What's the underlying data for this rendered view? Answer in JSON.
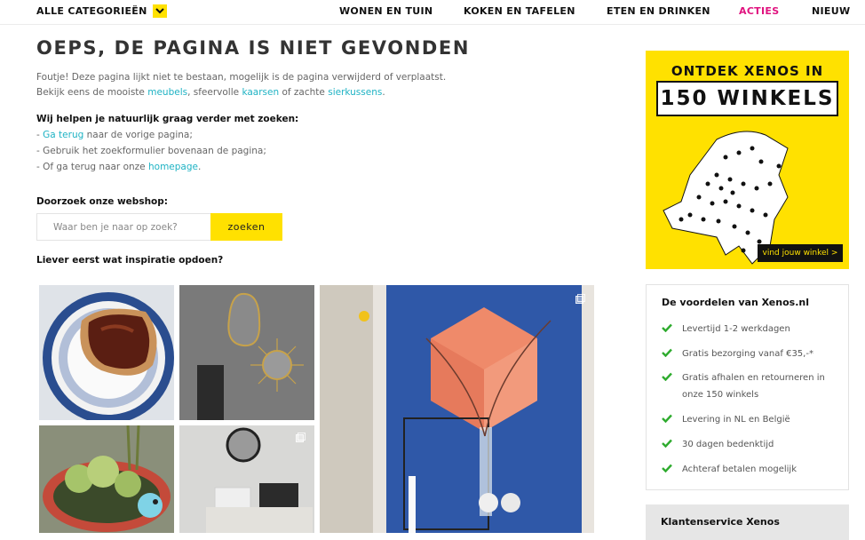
{
  "nav": {
    "categories_label": "ALLE CATEGORIEËN",
    "items": [
      {
        "label": "WONEN EN TUIN"
      },
      {
        "label": "KOKEN EN TAFELEN"
      },
      {
        "label": "ETEN EN DRINKEN"
      },
      {
        "label": "ACTIES"
      },
      {
        "label": "NIEUW"
      }
    ],
    "highlight_color": "#e0137f"
  },
  "page": {
    "title": "OEPS, DE PAGINA IS NIET GEVONDEN",
    "intro_line1": "Foutje! Deze pagina lijkt niet te bestaan, mogelijk is de pagina verwijderd of verplaatst.",
    "intro_line2_prefix": "Bekijk eens de mooiste ",
    "link_meubels": "meubels",
    "intro_line2_mid1": ", sfeervolle ",
    "link_kaarsen": "kaarsen",
    "intro_line2_mid2": " of zachte ",
    "link_sierkussens": "sierkussens",
    "intro_line2_suffix": ".",
    "help_heading": "Wij helpen je natuurlijk graag verder met zoeken:",
    "help_item1_prefix": "- ",
    "help_item1_link": "Ga terug",
    "help_item1_suffix": " naar de vorige pagina;",
    "help_item2": "- Gebruik het zoekformulier bovenaan de pagina;",
    "help_item3_prefix": "- Of ga terug naar onze ",
    "help_item3_link": "homepage",
    "help_item3_suffix": ".",
    "search_heading": "Doorzoek onze webshop:",
    "inspiration_heading": "Liever eerst wat inspiratie opdoen?"
  },
  "search": {
    "placeholder": "Waar ben je naar op zoek?",
    "button_label": "zoeken"
  },
  "ad": {
    "line1": "ONTDEK XENOS IN",
    "line2": "150 WINKELS",
    "cta": "vind jouw winkel >",
    "bg_color": "#ffe100"
  },
  "benefits": {
    "title": "De voordelen van Xenos.nl",
    "items": [
      "Levertijd 1-2 werkdagen",
      "Gratis bezorging vanaf €35,-*",
      "Gratis afhalen en retourneren in onze 150 winkels",
      "Levering in NL en België",
      "30 dagen bedenktijd",
      "Achteraf betalen mogelijk"
    ],
    "check_color": "#2eab2e"
  },
  "service": {
    "title": "Klantenservice Xenos"
  },
  "accent_color": "#1fb3c4"
}
